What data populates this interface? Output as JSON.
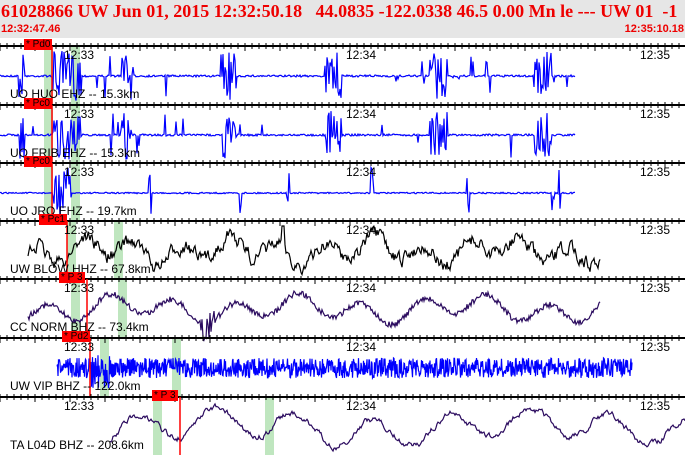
{
  "header": {
    "title": "61028866 UW Jun 01, 2015 12:32:50.18   44.0835 -122.0338 46.5 0.00 Mn le --- UW 01  -1",
    "start_time": "12:32:47.46",
    "end_time": "12:35:10.18"
  },
  "time_ticks": [
    "12:33",
    "12:34",
    "12:35"
  ],
  "traces": [
    {
      "label": "UO HUO EHZ -- 15.3km",
      "pick": "* Pd0",
      "color": "#0000ff"
    },
    {
      "label": "UO FRIB EHZ -- 15.3km",
      "pick": "* Pc0",
      "color": "#0000ff"
    },
    {
      "label": "UO JRO EHZ -- 19.7km",
      "pick": "* Pc0",
      "color": "#0000ff"
    },
    {
      "label": "UW BLOW HHZ -- 67.8km",
      "pick": "* Pc1",
      "color": "#000000"
    },
    {
      "label": "CC NORM BHZ -- 73.4km",
      "pick": "* P 3",
      "color": "#2a0a5e"
    },
    {
      "label": "UW VIP BHZ -- 122.0km",
      "pick": "* Pd2",
      "color": "#0000ff"
    },
    {
      "label": "TA L04D BHZ -- 208.6km",
      "pick": "* P 3",
      "color": "#2a0a5e"
    }
  ]
}
